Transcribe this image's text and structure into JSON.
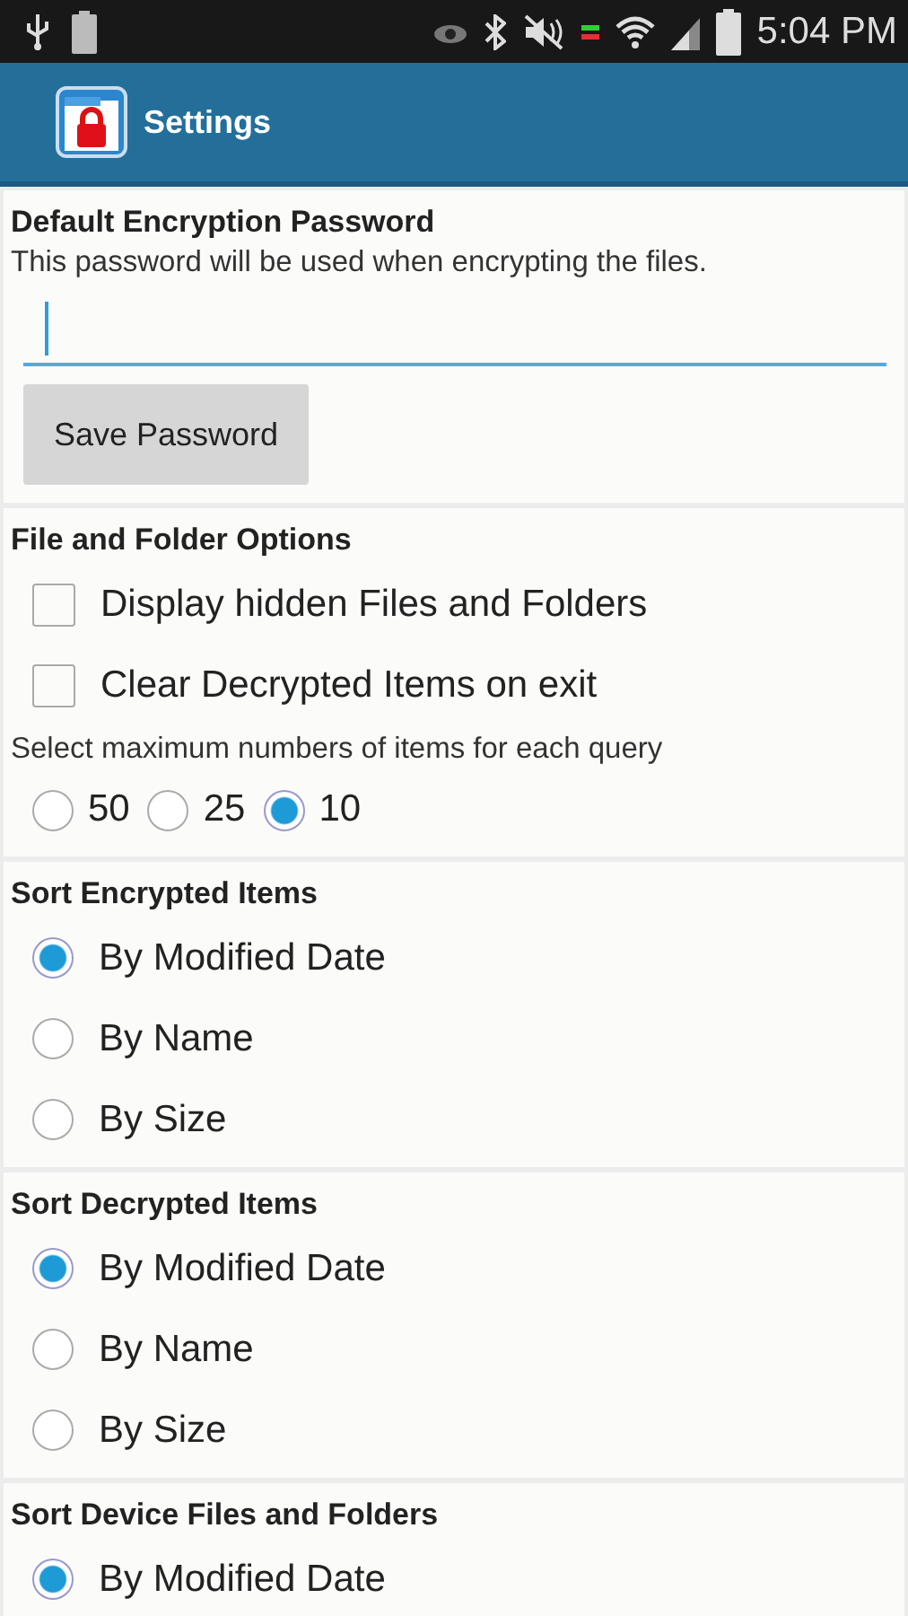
{
  "status_bar": {
    "time": "5:04 PM"
  },
  "app_bar": {
    "title": "Settings"
  },
  "password_section": {
    "title": "Default Encryption Password",
    "description": "This password will be used when encrypting the files.",
    "field": {
      "focused": true
    },
    "button": "Save Password"
  },
  "file_options": {
    "title": "File and Folder Options",
    "checkboxes": [
      {
        "label": "Display hidden Files and Folders",
        "checked": false
      },
      {
        "label": "Clear Decrypted Items on exit",
        "checked": false
      }
    ],
    "query_label": "Select maximum numbers of items for each query",
    "query_options": [
      {
        "label": "50",
        "selected": false
      },
      {
        "label": "25",
        "selected": false
      },
      {
        "label": "10",
        "selected": true
      }
    ]
  },
  "sort_sections": [
    {
      "title": "Sort Encrypted Items",
      "options": [
        {
          "label": "By Modified Date",
          "selected": true
        },
        {
          "label": "By Name",
          "selected": false
        },
        {
          "label": "By Size",
          "selected": false
        }
      ]
    },
    {
      "title": "Sort Decrypted Items",
      "options": [
        {
          "label": "By Modified Date",
          "selected": true
        },
        {
          "label": "By Name",
          "selected": false
        },
        {
          "label": "By Size",
          "selected": false
        }
      ]
    },
    {
      "title": "Sort Device Files and Folders",
      "options": [
        {
          "label": "By Modified Date",
          "selected": true
        }
      ]
    }
  ]
}
